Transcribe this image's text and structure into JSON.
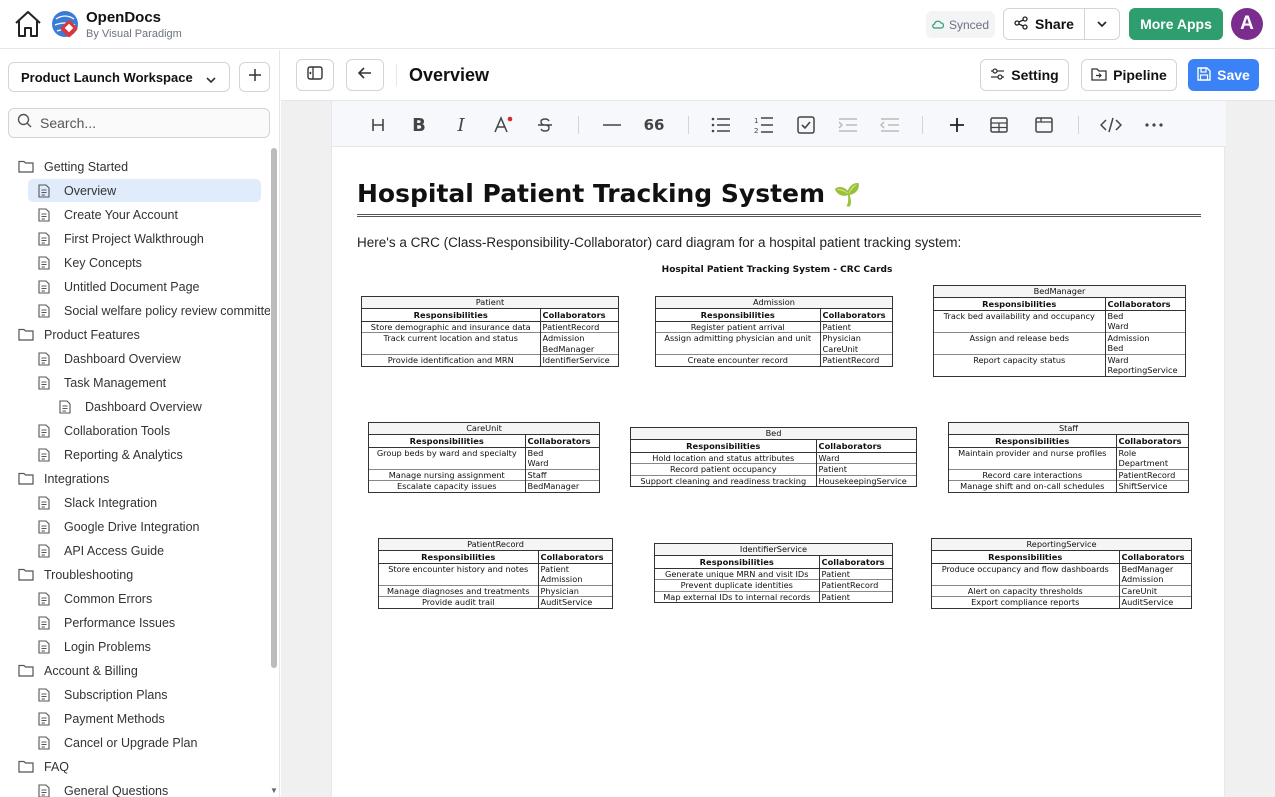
{
  "app": {
    "name": "OpenDocs",
    "subtitle": "By Visual Paradigm"
  },
  "header": {
    "synced": "Synced",
    "share": "Share",
    "more_apps": "More Apps",
    "avatar_letter": "A",
    "more_apps_color": "#2e9e6e",
    "avatar_color": "#7b2d8e"
  },
  "sidebar": {
    "workspace": "Product Launch Workspace",
    "search_placeholder": "Search...",
    "items": [
      {
        "label": "Getting Started",
        "type": "folder",
        "level": 0
      },
      {
        "label": "Overview",
        "type": "doc",
        "level": 1,
        "active": true
      },
      {
        "label": "Create Your Account",
        "type": "doc",
        "level": 1
      },
      {
        "label": "First Project Walkthrough",
        "type": "doc",
        "level": 1
      },
      {
        "label": "Key Concepts",
        "type": "doc",
        "level": 1
      },
      {
        "label": "Untitled Document Page",
        "type": "doc",
        "level": 1
      },
      {
        "label": "Social welfare policy review committee",
        "type": "doc",
        "level": 1
      },
      {
        "label": "Product Features",
        "type": "folder",
        "level": 0
      },
      {
        "label": "Dashboard Overview",
        "type": "doc",
        "level": 1
      },
      {
        "label": "Task Management",
        "type": "doc",
        "level": 1
      },
      {
        "label": "Dashboard Overview",
        "type": "doc",
        "level": 2
      },
      {
        "label": "Collaboration Tools",
        "type": "doc",
        "level": 1
      },
      {
        "label": "Reporting & Analytics",
        "type": "doc",
        "level": 1
      },
      {
        "label": "Integrations",
        "type": "folder",
        "level": 0
      },
      {
        "label": "Slack Integration",
        "type": "doc",
        "level": 1
      },
      {
        "label": "Google Drive Integration",
        "type": "doc",
        "level": 1
      },
      {
        "label": "API Access Guide",
        "type": "doc",
        "level": 1
      },
      {
        "label": "Troubleshooting",
        "type": "folder",
        "level": 0
      },
      {
        "label": "Common Errors",
        "type": "doc",
        "level": 1
      },
      {
        "label": "Performance Issues",
        "type": "doc",
        "level": 1
      },
      {
        "label": "Login Problems",
        "type": "doc",
        "level": 1
      },
      {
        "label": "Account & Billing",
        "type": "folder",
        "level": 0
      },
      {
        "label": "Subscription Plans",
        "type": "doc",
        "level": 1
      },
      {
        "label": "Payment Methods",
        "type": "doc",
        "level": 1
      },
      {
        "label": "Cancel or Upgrade Plan",
        "type": "doc",
        "level": 1
      },
      {
        "label": "FAQ",
        "type": "folder",
        "level": 0
      },
      {
        "label": "General Questions",
        "type": "doc",
        "level": 1
      }
    ]
  },
  "toolbar": {
    "page_title": "Overview",
    "setting": "Setting",
    "pipeline": "Pipeline",
    "save": "Save",
    "save_color": "#3b82f6"
  },
  "document": {
    "title": "Hospital Patient Tracking System",
    "title_emoji": "🌱",
    "intro": "Here's a CRC (Class-Responsibility-Collaborator) card diagram for a hospital patient tracking system:",
    "diagram_title": "Hospital Patient Tracking System - CRC Cards",
    "col_responsibilities": "Responsibilities",
    "col_collaborators": "Collaborators",
    "cards": [
      {
        "name": "Patient",
        "rows": [
          {
            "resp": "Store demographic and insurance data",
            "collab": [
              "PatientRecord"
            ]
          },
          {
            "resp": "Track current location and status",
            "collab": [
              "Admission",
              "BedManager"
            ]
          },
          {
            "resp": "Provide identification and MRN",
            "collab": [
              "IdentifierService"
            ]
          }
        ]
      },
      {
        "name": "Admission",
        "rows": [
          {
            "resp": "Register patient arrival",
            "collab": [
              "Patient"
            ]
          },
          {
            "resp": "Assign admitting physician and unit",
            "collab": [
              "Physician",
              "CareUnit"
            ]
          },
          {
            "resp": "Create encounter record",
            "collab": [
              "PatientRecord"
            ]
          }
        ]
      },
      {
        "name": "BedManager",
        "rows": [
          {
            "resp": "Track bed availability and occupancy",
            "collab": [
              "Bed",
              "Ward"
            ]
          },
          {
            "resp": "Assign and release beds",
            "collab": [
              "Admission",
              "Bed"
            ]
          },
          {
            "resp": "Report capacity status",
            "collab": [
              "Ward",
              "ReportingService"
            ]
          }
        ]
      },
      {
        "name": "CareUnit",
        "rows": [
          {
            "resp": "Group beds by ward and specialty",
            "collab": [
              "Bed",
              "Ward"
            ]
          },
          {
            "resp": "Manage nursing assignment",
            "collab": [
              "Staff"
            ]
          },
          {
            "resp": "Escalate capacity issues",
            "collab": [
              "BedManager"
            ]
          }
        ]
      },
      {
        "name": "Bed",
        "rows": [
          {
            "resp": "Hold location and status attributes",
            "collab": [
              "Ward"
            ]
          },
          {
            "resp": "Record patient occupancy",
            "collab": [
              "Patient"
            ]
          },
          {
            "resp": "Support cleaning and readiness tracking",
            "collab": [
              "HousekeepingService"
            ]
          }
        ]
      },
      {
        "name": "Staff",
        "rows": [
          {
            "resp": "Maintain provider and nurse profiles",
            "collab": [
              "Role",
              "Department"
            ]
          },
          {
            "resp": "Record care interactions",
            "collab": [
              "PatientRecord"
            ]
          },
          {
            "resp": "Manage shift and on-call schedules",
            "collab": [
              "ShiftService"
            ]
          }
        ]
      },
      {
        "name": "PatientRecord",
        "rows": [
          {
            "resp": "Store encounter history and notes",
            "collab": [
              "Patient",
              "Admission"
            ]
          },
          {
            "resp": "Manage diagnoses and treatments",
            "collab": [
              "Physician"
            ]
          },
          {
            "resp": "Provide audit trail",
            "collab": [
              "AuditService"
            ]
          }
        ]
      },
      {
        "name": "IdentifierService",
        "rows": [
          {
            "resp": "Generate unique MRN and visit IDs",
            "collab": [
              "Patient"
            ]
          },
          {
            "resp": "Prevent duplicate identities",
            "collab": [
              "PatientRecord"
            ]
          },
          {
            "resp": "Map external IDs to internal records",
            "collab": [
              "Patient"
            ]
          }
        ]
      },
      {
        "name": "ReportingService",
        "rows": [
          {
            "resp": "Produce occupancy and flow dashboards",
            "collab": [
              "BedManager",
              "Admission"
            ]
          },
          {
            "resp": "Alert on capacity thresholds",
            "collab": [
              "CareUnit"
            ]
          },
          {
            "resp": "Export compliance reports",
            "collab": [
              "AuditService"
            ]
          }
        ]
      }
    ]
  }
}
